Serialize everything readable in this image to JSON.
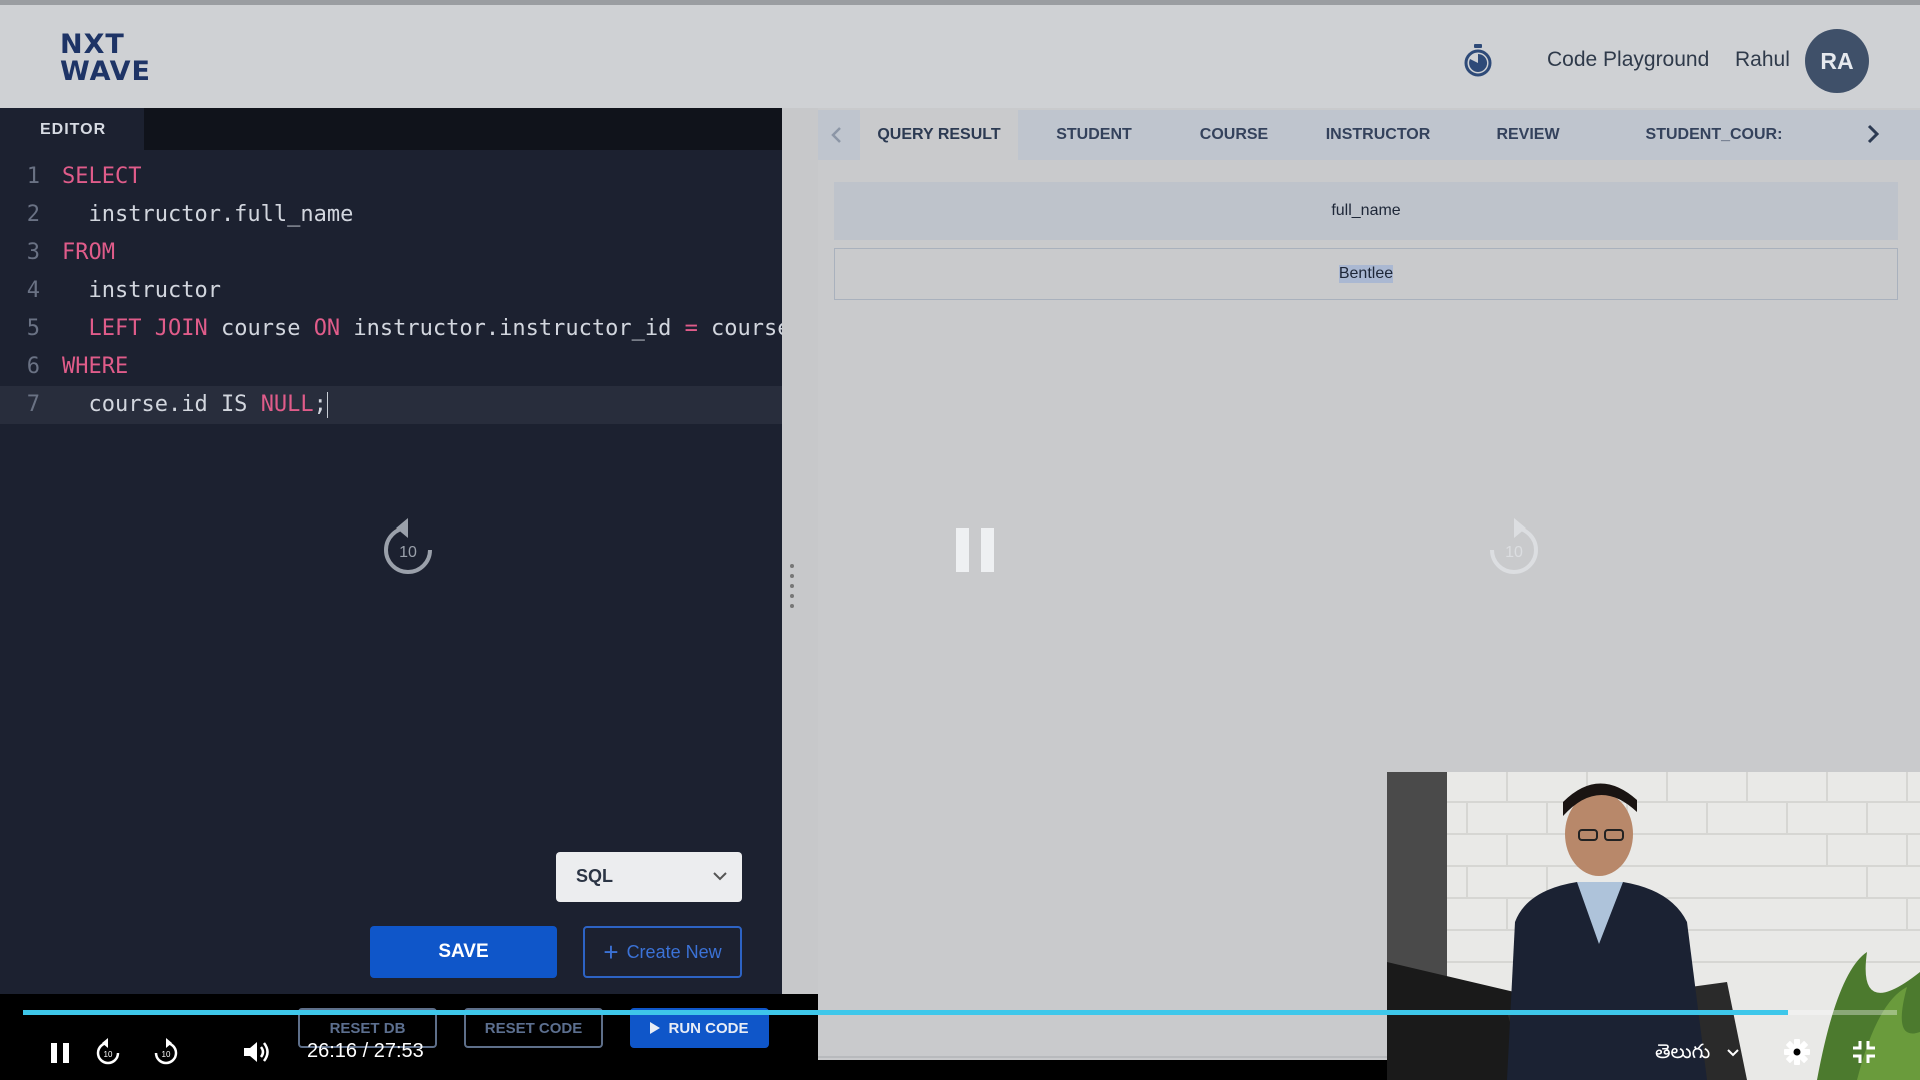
{
  "header": {
    "logo_line1": "NXT",
    "logo_line2": "WAVE",
    "link": "Code Playground",
    "user_name": "Rahul",
    "avatar_initials": "RA"
  },
  "editor": {
    "tab_label": "EDITOR",
    "lines": [
      {
        "n": "1",
        "parts": [
          {
            "t": "SELECT",
            "kw": true
          }
        ]
      },
      {
        "n": "2",
        "parts": [
          {
            "t": "  instructor.full_name",
            "kw": false
          }
        ]
      },
      {
        "n": "3",
        "parts": [
          {
            "t": "FROM",
            "kw": true
          }
        ]
      },
      {
        "n": "4",
        "parts": [
          {
            "t": "  instructor",
            "kw": false
          }
        ]
      },
      {
        "n": "5",
        "parts": [
          {
            "t": "  ",
            "kw": false
          },
          {
            "t": "LEFT JOIN",
            "kw": true
          },
          {
            "t": " course ",
            "kw": false
          },
          {
            "t": "ON",
            "kw": true
          },
          {
            "t": " instructor.instructor_id ",
            "kw": false
          },
          {
            "t": "=",
            "kw": true
          },
          {
            "t": " course.",
            "kw": false
          }
        ]
      },
      {
        "n": "6",
        "parts": [
          {
            "t": "WHERE",
            "kw": true
          }
        ]
      },
      {
        "n": "7",
        "parts": [
          {
            "t": "  course.id IS ",
            "kw": false
          },
          {
            "t": "NULL",
            "kw": true
          },
          {
            "t": ";",
            "kw": false
          }
        ],
        "active": true
      }
    ],
    "seek_back_label": "10",
    "language": "SQL",
    "save_label": "SAVE",
    "create_label": "Create New"
  },
  "result": {
    "tabs": [
      "QUERY RESULT",
      "STUDENT",
      "COURSE",
      "INSTRUCTOR",
      "REVIEW",
      "STUDENT_COUR:"
    ],
    "active_tab": 0,
    "column_header": "full_name",
    "row_value": "Bentlee",
    "seek_forward_label": "10"
  },
  "actions": {
    "reset_db": "RESET DB",
    "reset_code": "RESET CODE",
    "run_code": "RUN CODE"
  },
  "player": {
    "current_time": "26:16",
    "separator": "/",
    "duration": "27:53",
    "progress": 0.942,
    "language": "తెలుగు",
    "accent_color": "#3ec7ea"
  },
  "colors": {
    "primary_button": "#0f56c9",
    "editor_bg": "#1c2130",
    "keyword": "#e05c8a"
  }
}
